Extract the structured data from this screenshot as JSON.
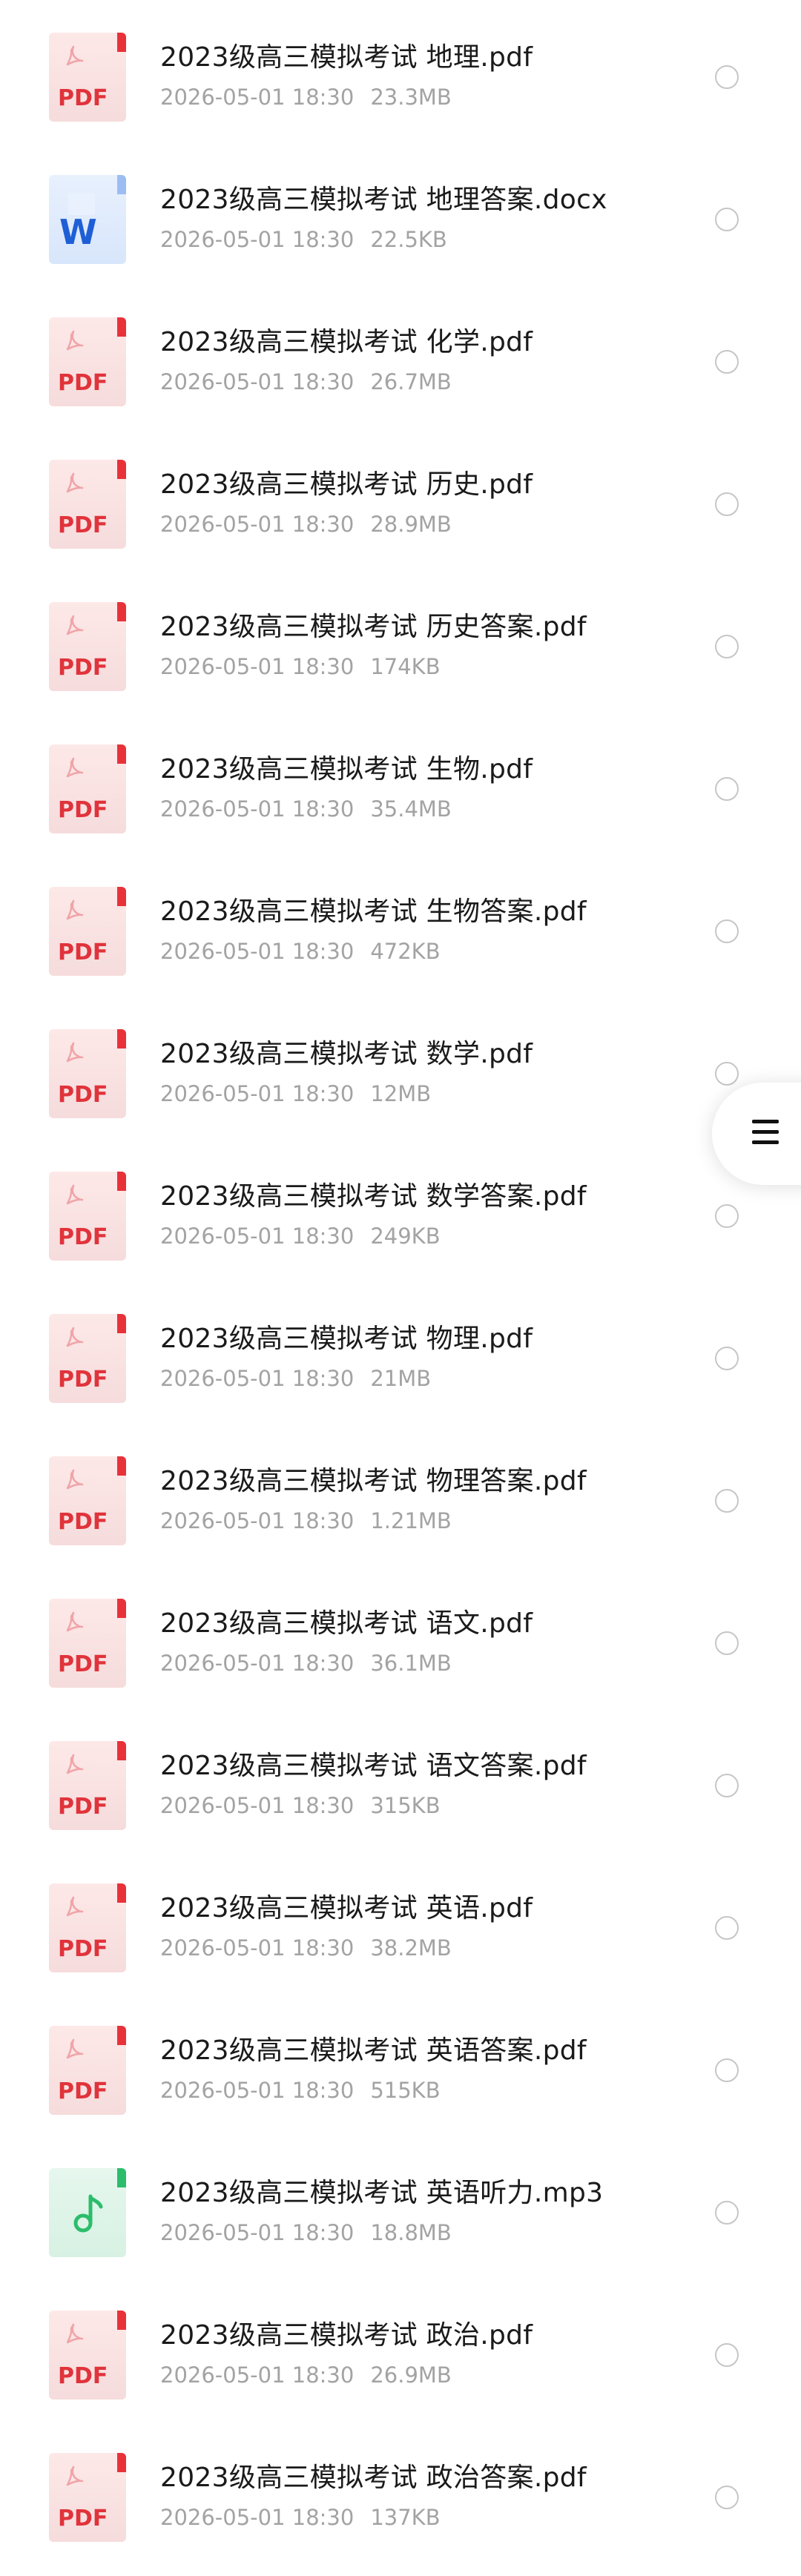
{
  "files": [
    {
      "name": "2023级高三模拟考试 地理.pdf",
      "date": "2026-05-01 18:30",
      "size": "23.3MB",
      "type": "pdf"
    },
    {
      "name": "2023级高三模拟考试 地理答案.docx",
      "date": "2026-05-01 18:30",
      "size": "22.5KB",
      "type": "docx"
    },
    {
      "name": "2023级高三模拟考试 化学.pdf",
      "date": "2026-05-01 18:30",
      "size": "26.7MB",
      "type": "pdf"
    },
    {
      "name": "2023级高三模拟考试 历史.pdf",
      "date": "2026-05-01 18:30",
      "size": "28.9MB",
      "type": "pdf"
    },
    {
      "name": "2023级高三模拟考试 历史答案.pdf",
      "date": "2026-05-01 18:30",
      "size": "174KB",
      "type": "pdf"
    },
    {
      "name": "2023级高三模拟考试 生物.pdf",
      "date": "2026-05-01 18:30",
      "size": "35.4MB",
      "type": "pdf"
    },
    {
      "name": "2023级高三模拟考试 生物答案.pdf",
      "date": "2026-05-01 18:30",
      "size": "472KB",
      "type": "pdf"
    },
    {
      "name": "2023级高三模拟考试 数学.pdf",
      "date": "2026-05-01 18:30",
      "size": "12MB",
      "type": "pdf"
    },
    {
      "name": "2023级高三模拟考试 数学答案.pdf",
      "date": "2026-05-01 18:30",
      "size": "249KB",
      "type": "pdf"
    },
    {
      "name": "2023级高三模拟考试 物理.pdf",
      "date": "2026-05-01 18:30",
      "size": "21MB",
      "type": "pdf"
    },
    {
      "name": "2023级高三模拟考试 物理答案.pdf",
      "date": "2026-05-01 18:30",
      "size": "1.21MB",
      "type": "pdf"
    },
    {
      "name": "2023级高三模拟考试 语文.pdf",
      "date": "2026-05-01 18:30",
      "size": "36.1MB",
      "type": "pdf"
    },
    {
      "name": "2023级高三模拟考试 语文答案.pdf",
      "date": "2026-05-01 18:30",
      "size": "315KB",
      "type": "pdf"
    },
    {
      "name": "2023级高三模拟考试 英语.pdf",
      "date": "2026-05-01 18:30",
      "size": "38.2MB",
      "type": "pdf"
    },
    {
      "name": "2023级高三模拟考试 英语答案.pdf",
      "date": "2026-05-01 18:30",
      "size": "515KB",
      "type": "pdf"
    },
    {
      "name": "2023级高三模拟考试 英语听力.mp3",
      "date": "2026-05-01 18:30",
      "size": "18.8MB",
      "type": "mp3"
    },
    {
      "name": "2023级高三模拟考试 政治.pdf",
      "date": "2026-05-01 18:30",
      "size": "26.9MB",
      "type": "pdf"
    },
    {
      "name": "2023级高三模拟考试 政治答案.pdf",
      "date": "2026-05-01 18:30",
      "size": "137KB",
      "type": "pdf"
    }
  ],
  "icons": {
    "pdf": {
      "label": "PDF",
      "icon_name": "pdf-file-icon",
      "color": "#e0333b"
    },
    "docx": {
      "label": "W",
      "icon_name": "word-file-icon",
      "color": "#1f5fd6"
    },
    "mp3": {
      "icon_name": "music-file-icon",
      "color": "#2bbd6b"
    }
  },
  "float_menu": {
    "icon_name": "menu-icon"
  }
}
